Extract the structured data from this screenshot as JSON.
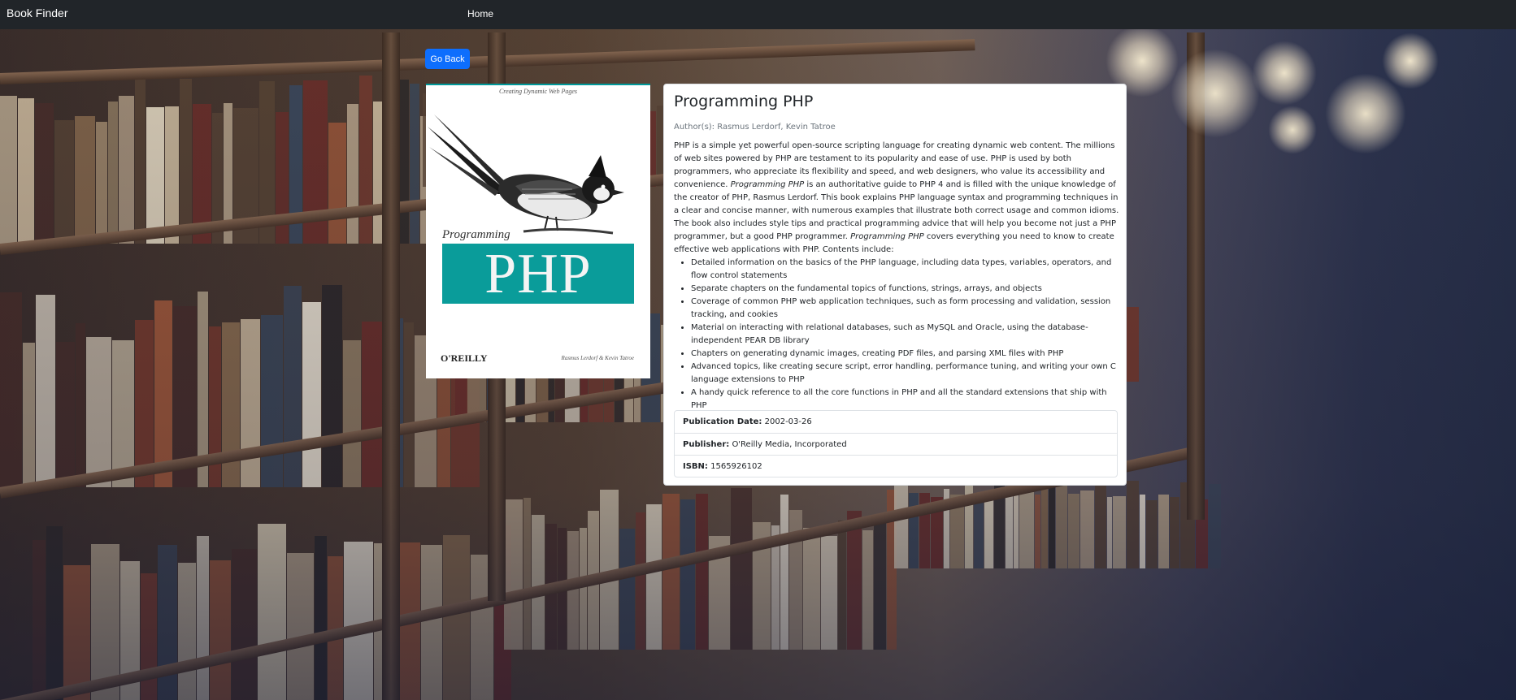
{
  "navbar": {
    "brand": "Book Finder",
    "home_link": "Home"
  },
  "go_back_label": "Go Back",
  "cover": {
    "tagline": "Creating Dynamic Web Pages",
    "series_word": "Programming",
    "title_word": "PHP",
    "publisher_mark": "O'REILLY",
    "cover_authors": "Rasmus Lerdorf & Kevin Tatroe",
    "band_color": "#0a9c9a"
  },
  "book": {
    "title": "Programming PHP",
    "authors_line": "Author(s): Rasmus Lerdorf, Kevin Tatroe",
    "description": {
      "part1": "PHP is a simple yet powerful open-source scripting language for creating dynamic web content. The millions of web sites powered by PHP are testament to its popularity and ease of use. PHP is used by both programmers, who appreciate its flexibility and speed, and web designers, who value its accessibility and convenience. ",
      "em1": "Programming PHP",
      "part2": " is an authoritative guide to PHP 4 and is filled with the unique knowledge of the creator of PHP, Rasmus Lerdorf. This book explains PHP language syntax and programming techniques in a clear and concise manner, with numerous examples that illustrate both correct usage and common idioms. The book also includes style tips and practical programming advice that will help you become not just a PHP programmer, but a good PHP programmer. ",
      "em2": "Programming PHP",
      "part3": " covers everything you need to know to create effective web applications with PHP. Contents include:",
      "bullets": [
        "Detailed information on the basics of the PHP language, including data types, variables, operators, and flow control statements",
        "Separate chapters on the fundamental topics of functions, strings, arrays, and objects",
        "Coverage of common PHP web application techniques, such as form processing and validation, session tracking, and cookies",
        "Material on interacting with relational databases, such as MySQL and Oracle, using the database-independent PEAR DB library",
        "Chapters on generating dynamic images, creating PDF files, and parsing XML files with PHP",
        "Advanced topics, like creating secure script, error handling, performance tuning, and writing your own C language extensions to PHP",
        "A handy quick reference to all the core functions in PHP and all the standard extensions that ship with PHP"
      ]
    },
    "details": {
      "publication_date_label": "Publication Date:",
      "publication_date": "2002-03-26",
      "publisher_label": "Publisher:",
      "publisher": "O'Reilly Media, Incorporated",
      "isbn_label": "ISBN:",
      "isbn": "1565926102"
    }
  },
  "colors": {
    "navbar": "#212529",
    "button": "#0d6efd"
  }
}
